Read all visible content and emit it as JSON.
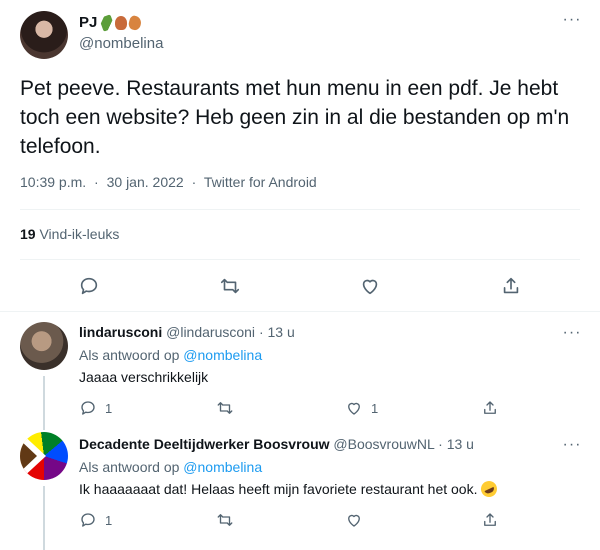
{
  "main_tweet": {
    "display_name": "PJ",
    "handle": "@nombelina",
    "text": "Pet peeve. Restaurants met hun menu in een pdf. Je hebt toch een website? Heb geen zin in al die bestanden op m'n telefoon.",
    "time": "10:39 p.m.",
    "date": "30 jan. 2022",
    "source": "Twitter for Android",
    "likes_count": "19",
    "likes_label": "Vind-ik-leuks",
    "more_icon": "···",
    "action_icons": [
      "reply-icon",
      "retweet-icon",
      "like-icon",
      "share-icon"
    ]
  },
  "replies": [
    {
      "display_name": "lindarusconi",
      "handle": "@lindarusconi",
      "time": "13 u",
      "replying_to_label": "Als antwoord op",
      "replying_to_handle": "@nombelina",
      "text": "Jaaaa verschrikkelijk",
      "reply_count": "1",
      "like_count": "1"
    },
    {
      "display_name": "Decadente Deeltijdwerker Boosvrouw",
      "handle": "@BoosvrouwNL",
      "time": "13 u",
      "replying_to_label": "Als antwoord op",
      "replying_to_handle": "@nombelina",
      "text": "Ik haaaaaaat dat! Helaas heeft mijn favoriete restaurant het ook.",
      "reply_count": "1",
      "like_count": ""
    }
  ],
  "colors": {
    "text_primary": "#0f1419",
    "text_secondary": "#536471",
    "accent_link": "#1d9bf0",
    "divider": "#eff3f4",
    "thread_line": "#cfd9de"
  }
}
